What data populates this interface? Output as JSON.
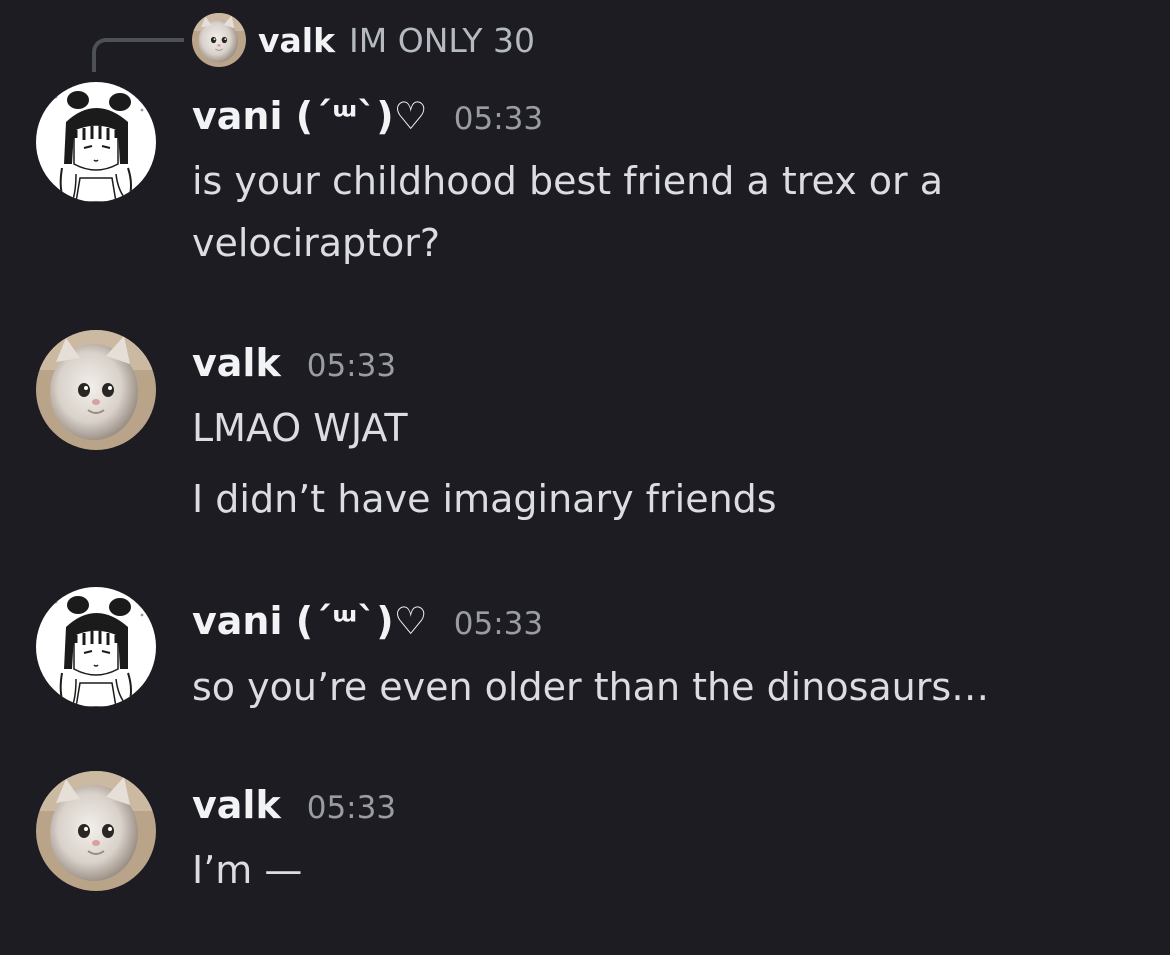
{
  "reply_preview": {
    "author": "valk",
    "text": "IM ONLY 30",
    "avatar_icon": "cat-avatar-icon"
  },
  "messages": [
    {
      "author": "vani (´ᵚ`)♡",
      "time": "05:33",
      "avatar_icon": "anime-girl-avatar-icon",
      "lines": [
        "is your childhood best friend a trex or a",
        "velociraptor?"
      ]
    },
    {
      "author": "valk",
      "time": "05:33",
      "avatar_icon": "cat-avatar-icon",
      "lines": [
        "LMAO WJAT",
        "I didn’t have imaginary friends"
      ]
    },
    {
      "author": "vani (´ᵚ`)♡",
      "time": "05:33",
      "avatar_icon": "anime-girl-avatar-icon",
      "lines": [
        "so you’re even older than the dinosaurs…"
      ]
    },
    {
      "author": "valk",
      "time": "05:33",
      "avatar_icon": "cat-avatar-icon",
      "lines": [
        "I’m —"
      ]
    }
  ],
  "colors": {
    "background": "#1c1c22",
    "author": "#f2f3f5",
    "timestamp": "#9a9ca4",
    "message_text": "#dcdde1",
    "reply_line": "#4e5058"
  }
}
